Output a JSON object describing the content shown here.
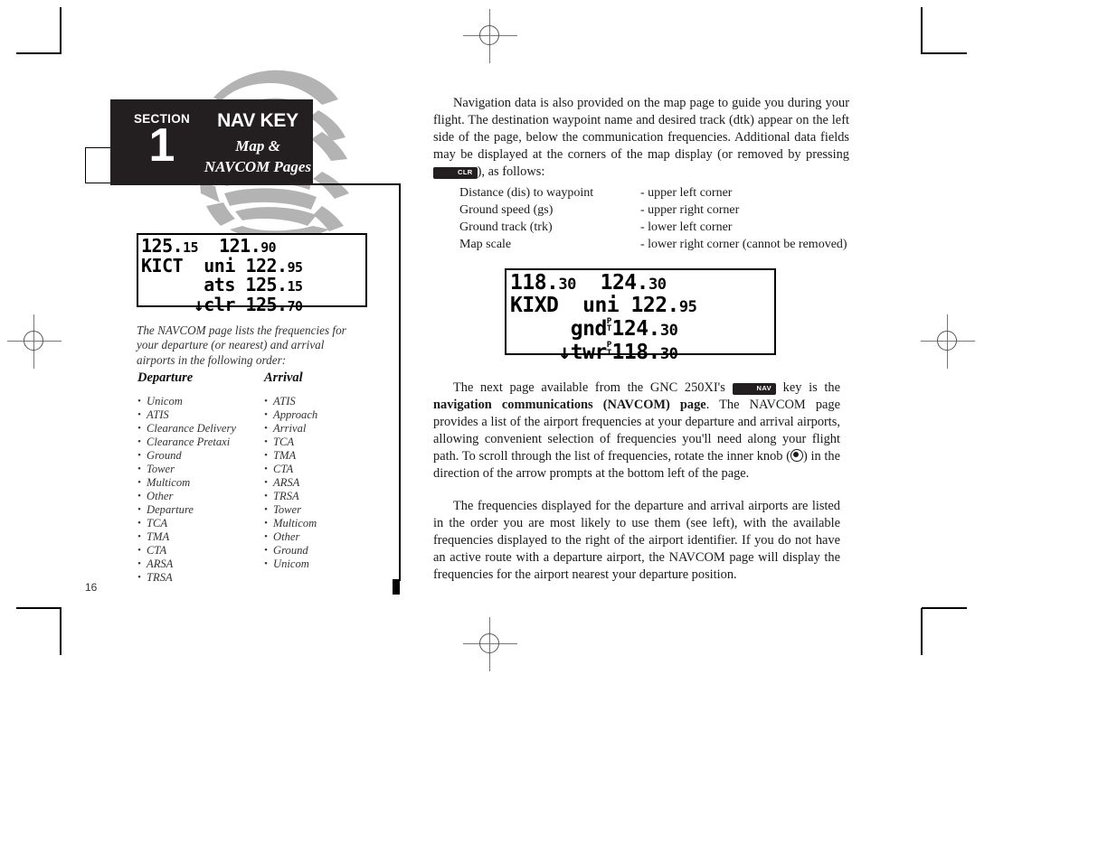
{
  "section_tab": {
    "section_word": "SECTION",
    "section_number": "1",
    "title": "NAV KEY",
    "subtitle_line1": "Map &",
    "subtitle_line2": "NAVCOM Pages"
  },
  "page_number": "16",
  "lcd_departure": {
    "line1_left": "125.",
    "line1_left_dec": "15",
    "line1_right": "121.",
    "line1_right_dec": "90",
    "line2_ident": "KICT",
    "line2_label": "uni",
    "line2_freq": "122.",
    "line2_freq_dec": "95",
    "line3_label": "ats",
    "line3_freq": "125.",
    "line3_freq_dec": "15",
    "line4_arrow": "↓",
    "line4_label": "clr",
    "line4_freq": "125.",
    "line4_freq_dec": "70"
  },
  "lcd_arrival": {
    "line1_left": "118.",
    "line1_left_dec": "30",
    "line1_right": "124.",
    "line1_right_dec": "30",
    "line2_ident": "KIXD",
    "line2_label": "uni",
    "line2_freq": "122.",
    "line2_freq_dec": "95",
    "line3_label": "gnd",
    "line3_pt_top": "P",
    "line3_pt_bottom": "T",
    "line3_freq": "124.",
    "line3_freq_dec": "30",
    "line4_arrow": "↓",
    "line4_label": "twr",
    "line4_pt_top": "P",
    "line4_pt_bottom": "T",
    "line4_freq": "118.",
    "line4_freq_dec": "30"
  },
  "caption": "The NAVCOM page lists the frequencies for your departure (or nearest) and arrival airports in the following order:",
  "departure_list": {
    "heading": "Departure",
    "items": [
      "Unicom",
      "ATIS",
      "Clearance Delivery",
      "Clearance Pretaxi",
      "Ground",
      "Tower",
      "Multicom",
      "Other",
      "Departure",
      "TCA",
      "TMA",
      "CTA",
      "ARSA",
      "TRSA"
    ]
  },
  "arrival_list": {
    "heading": "Arrival",
    "items": [
      "ATIS",
      "Approach",
      "Arrival",
      "TCA",
      "TMA",
      "CTA",
      "ARSA",
      "TRSA",
      "Tower",
      "Multicom",
      "Other",
      "Ground",
      "Unicom"
    ]
  },
  "paragraph_1": {
    "text_before_key": "Navigation data is also provided on the map page to guide you during your flight. The destination waypoint name and desired track (dtk) appear on the left side of the page, below the communication frequencies.  Additional data fields may be displayed at the corners of the map display (or removed by pressing ",
    "key_label": "CLR",
    "text_after_key": "), as follows:"
  },
  "corner_data": {
    "rows": [
      {
        "field": "Distance (dis) to waypoint",
        "location": "- upper left corner"
      },
      {
        "field": "Ground speed (gs)",
        "location": "- upper right corner"
      },
      {
        "field": "Ground track (trk)",
        "location": "- lower left corner"
      },
      {
        "field": "Map scale",
        "location": "- lower right corner (cannot be removed)"
      }
    ]
  },
  "paragraph_2": {
    "seg1": "The next page available from the GNC 250XI's ",
    "key_label": "NAV",
    "seg2": " key is the ",
    "bold_text": "navigation communications (NAVCOM) page",
    "seg3": ". The NAVCOM page provides a list of the airport frequencies at your departure and arrival airports, allowing convenient selection of frequencies you'll need along your flight path. To scroll through the list of frequencies, rotate the inner knob (",
    "seg4": ") in the direction of the arrow prompts at the bottom left of the page."
  },
  "paragraph_3": {
    "text": "The frequencies displayed for the departure and arrival airports are listed in the order you are most likely to use them (see left), with the available frequencies displayed to the right of the airport identifier. If you do not have an active route with a departure airport, the NAVCOM page will display the frequencies for the airport nearest your departure position."
  },
  "colors": {
    "tab_background": "#231f20",
    "watermark_gray": "#b3b3b3",
    "text": "#1a1a1a"
  }
}
